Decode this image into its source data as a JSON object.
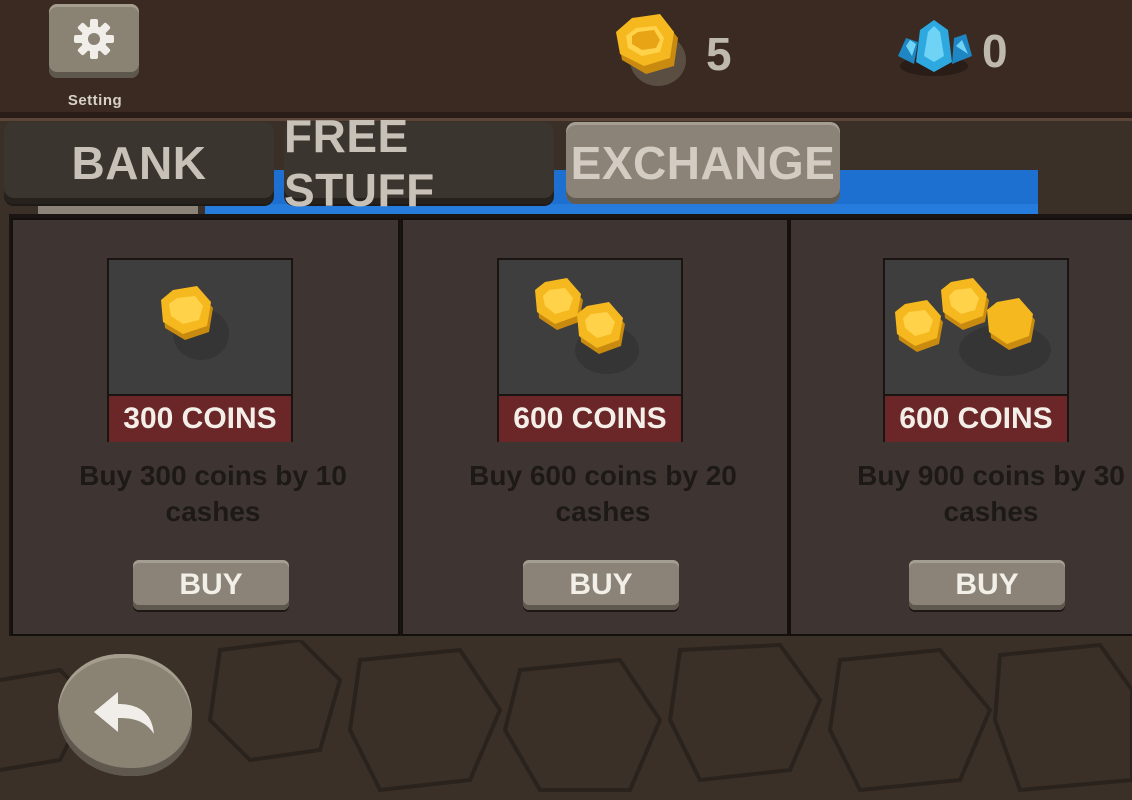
{
  "header": {
    "setting_label": "Setting",
    "coins": "5",
    "gems": "0"
  },
  "tabs": [
    {
      "label": "BANK",
      "active": false
    },
    {
      "label": "FREE STUFF",
      "active": false
    },
    {
      "label": "EXCHANGE",
      "active": true
    }
  ],
  "offers": [
    {
      "tag": "300 COINS",
      "description": "Buy 300 coins by 10\ncashes",
      "buy_label": "BUY",
      "coin_count": 1
    },
    {
      "tag": "600 COINS",
      "description": "Buy 600 coins by 20\ncashes",
      "buy_label": "BUY",
      "coin_count": 2
    },
    {
      "tag": "600 COINS",
      "description": "Buy 900 coins by 30\ncashes",
      "buy_label": "BUY",
      "coin_count": 3
    }
  ],
  "icons": {
    "settings": "gear-icon",
    "coin": "coin-icon",
    "gem": "gem-icon",
    "back": "back-arrow-icon"
  },
  "colors": {
    "coin_gold": "#f5b91f",
    "gem_blue": "#2ea9e0",
    "tag_red": "#6b2628",
    "stone": "#8b8377",
    "accent_blue": "#1d6fd0"
  }
}
